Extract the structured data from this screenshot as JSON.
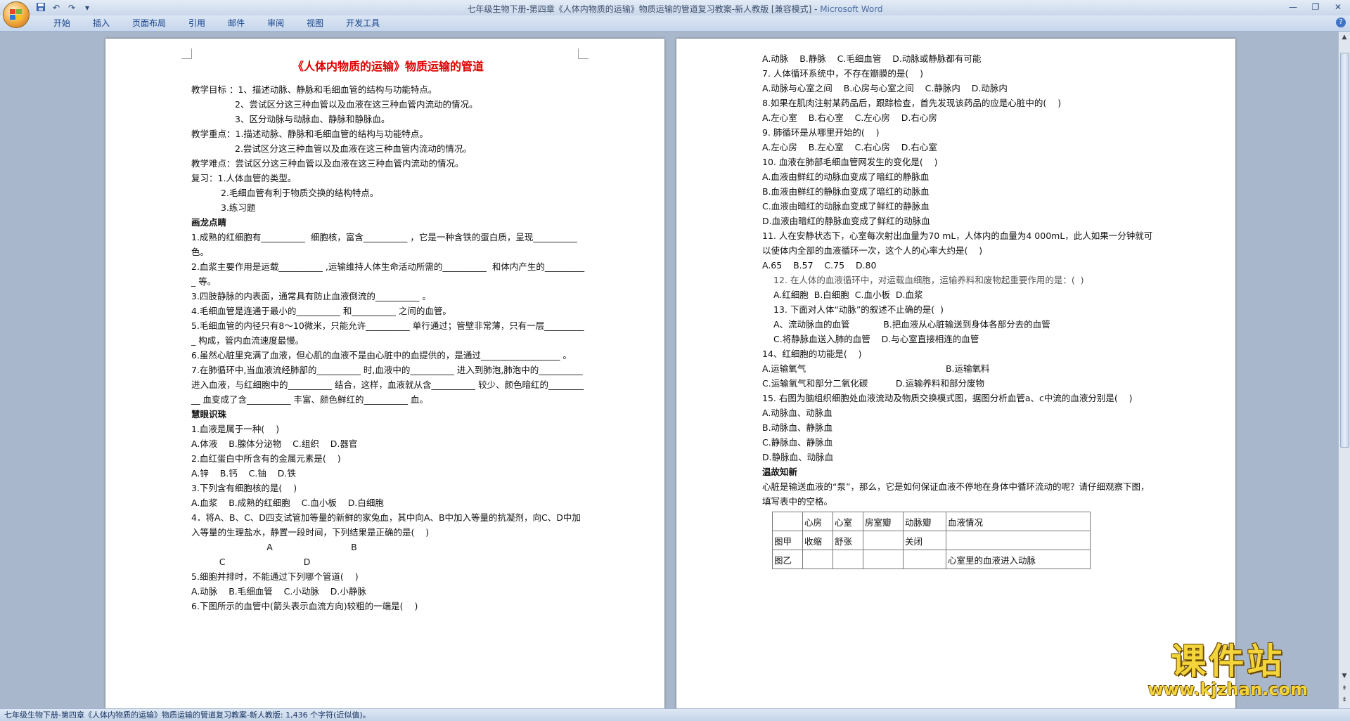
{
  "window": {
    "title": "七年级生物下册-第四章《人体内物质的运输》物质运输的管道复习教案-新人教版 [兼容模式] - ",
    "app_name": "Microsoft Word"
  },
  "menu": [
    "开始",
    "插入",
    "页面布局",
    "引用",
    "邮件",
    "审阅",
    "视图",
    "开发工具"
  ],
  "page1": {
    "title": "《人体内物质的运输》物质运输的管道",
    "lines": [
      {
        "t": "教学目标 ：1、描述动脉、静脉和毛细血管的结构与功能特点。",
        "s": ""
      },
      {
        "t": "2、尝试区分这三种血管以及血液在这三种血管内流动的情况。",
        "s": "indent2"
      },
      {
        "t": "3、区分动脉与动脉血、静脉和静脉血。",
        "s": "indent2"
      },
      {
        "t": "教学重点：1.描述动脉、静脉和毛细血管的结构与功能特点。",
        "s": ""
      },
      {
        "t": "2.尝试区分这三种血管以及血液在这三种血管内流动的情况。",
        "s": "indent2"
      },
      {
        "t": "教学难点：尝试区分这三种血管以及血液在这三种血管内流动的情况。",
        "s": ""
      },
      {
        "t": "复习：1.人体血管的类型。",
        "s": ""
      },
      {
        "t": "2.毛细血管有利于物质交换的结构特点。",
        "s": "indent3"
      },
      {
        "t": "3.练习题",
        "s": "indent3"
      },
      {
        "t": "画龙点睛",
        "s": "bold"
      },
      {
        "t": "1.成熟的红细胞有__________  细胞核，富含__________ ，它是一种含铁的蛋白质，呈现__________ 色。",
        "s": ""
      },
      {
        "t": "2.血浆主要作用是运载__________ ,运输维持人体生命活动所需的__________  和体内产生的__________ 等。",
        "s": ""
      },
      {
        "t": "3.四肢静脉的内表面，通常具有防止血液倒流的__________ 。",
        "s": ""
      },
      {
        "t": "4.毛细血管是连通于最小的__________ 和__________ 之间的血管。",
        "s": ""
      },
      {
        "t": "5.毛细血管的内径只有8～10微米，只能允许__________ 单行通过；管壁非常薄，只有一层__________ 构成，管内血流速度最慢。",
        "s": ""
      },
      {
        "t": "6.虽然心脏里充满了血液，但心肌的血液不是由心脏中的血提供的，是通过__________________ 。",
        "s": ""
      },
      {
        "t": "7.在肺循环中,当血液流经肺部的__________ 时,血液中的__________ 进入到肺泡,肺泡中的__________ 进入血液，与红细胞中的__________ 结合，这样，血液就从含__________ 较少、颜色暗红的__________ 血变成了含__________ 丰富、颜色鲜红的__________ 血。",
        "s": ""
      },
      {
        "t": "慧眼识珠",
        "s": "bold"
      },
      {
        "t": "1.血液是属于一种(    )",
        "s": ""
      },
      {
        "t": "A.体液    B.腺体分泌物    C.组织    D.器官",
        "s": ""
      },
      {
        "t": "2.血红蛋白中所含有的金属元素是(    )",
        "s": ""
      },
      {
        "t": "A.锌    B.钙    C.铀    D.铁",
        "s": ""
      },
      {
        "t": "3.下列含有细胞核的是(    )",
        "s": ""
      },
      {
        "t": "A.血浆    B.成熟的红细胞    C.血小板    D.白细胞",
        "s": ""
      },
      {
        "t": "4．将A、B、C、D四支试管加等量的新鲜的家兔血，其中向A、B中加入等量的抗凝剂，向C、D中加入等量的生理盐水，静置一段时间，下列结果是正确的是(    )",
        "s": ""
      },
      {
        "t": "                           A                            B",
        "s": ""
      },
      {
        "t": "          C                            D",
        "s": ""
      },
      {
        "t": "5.细胞并排时，不能通过下列哪个管道(    )",
        "s": ""
      },
      {
        "t": "A.动脉    B.毛细血管    C.小动脉    D.小静脉",
        "s": ""
      },
      {
        "t": "6.下图所示的血管中(箭头表示血流方向)较粗的一端是(    )",
        "s": ""
      }
    ]
  },
  "page2": {
    "lines": [
      {
        "t": "A.动脉    B.静脉    C.毛细血管    D.动脉或静脉都有可能",
        "s": ""
      },
      {
        "t": "7. 人体循环系统中，不存在瓣膜的是(    )",
        "s": ""
      },
      {
        "t": "A.动脉与心室之间    B.心房与心室之间    C.静脉内    D.动脉内",
        "s": ""
      },
      {
        "t": "8.如果在肌肉注射某药品后，跟踪检查，首先发现该药品的应是心脏中的(    )",
        "s": ""
      },
      {
        "t": "A.左心室    B.右心室    C.左心房    D.右心房",
        "s": ""
      },
      {
        "t": "9. 肺循环是从哪里开始的(    )",
        "s": ""
      },
      {
        "t": "A.左心房    B.左心室    C.右心房    D.右心室",
        "s": ""
      },
      {
        "t": "10. 血液在肺部毛细血管网发生的变化是(    )",
        "s": ""
      },
      {
        "t": "A.血液由鲜红的动脉血变成了暗红的静脉血",
        "s": ""
      },
      {
        "t": "B.血液由鲜红的静脉血变成了暗红的动脉血",
        "s": ""
      },
      {
        "t": "C.血液由暗红的动脉血变成了鲜红的静脉血",
        "s": ""
      },
      {
        "t": "D.血液由暗红的静脉血变成了鲜红的动脉血",
        "s": ""
      },
      {
        "t": "11. 人在安静状态下，心室每次射出血量为70 mL，人体内的血量为4 000mL，此人如果一分钟就可以使体内全部的血液循环一次，这个人的心率大约是(    )",
        "s": ""
      },
      {
        "t": "A.65    B.57    C.75    D.80",
        "s": ""
      },
      {
        "t": "12. 在人体的血液循环中，对运载血细胞，运输养料和废物起重要作用的是：(  )",
        "s": "indent gray"
      },
      {
        "t": "A.红细胞  B.白细胞  C.血小板  D.血浆",
        "s": "indent"
      },
      {
        "t": "13. 下面对人体“动脉”的叙述不止确的是(  )",
        "s": "indent"
      },
      {
        "t": "A、流动脉血的血管            B.把血液从心脏输送到身体各部分去的血管",
        "s": "indent"
      },
      {
        "t": "C.将静脉血送入肺的血管    D.与心室直接相连的血管",
        "s": "indent"
      },
      {
        "t": "14、红细胞的功能是(    )",
        "s": ""
      },
      {
        "t": "A.运输氧气                                                  B.运输氧料",
        "s": ""
      },
      {
        "t": "C.运输氧气和部分二氧化碳          D.运输养料和部分废物",
        "s": ""
      },
      {
        "t": "15. 右图为脑组织细胞处血液流动及物质交换模式图，据图分析血管a、c中流的血液分别是(    )",
        "s": ""
      },
      {
        "t": "A.动脉血、动脉血",
        "s": ""
      },
      {
        "t": "B.动脉血、静脉血",
        "s": ""
      },
      {
        "t": "C.静脉血、静脉血",
        "s": ""
      },
      {
        "t": "D.静脉血、动脉血",
        "s": ""
      },
      {
        "t": "温故知新",
        "s": "bold"
      },
      {
        "t": "心脏是输送血液的“泵”，那么，它是如何保证血液不停地在身体中循环流动的呢？请仔细观察下图，填写表中的空格。",
        "s": ""
      }
    ],
    "table": [
      [
        "",
        "心房",
        "心室",
        "房室瓣",
        "动脉瓣",
        "血液情况"
      ],
      [
        "图甲",
        "收缩",
        "舒张",
        "",
        "关闭",
        ""
      ],
      [
        "图乙",
        "",
        "",
        "",
        "",
        "心室里的血液进入动脉"
      ]
    ]
  },
  "status": {
    "text": "七年级生物下册-第四章《人体内物质的运输》物质运输的管道复习教案-新人教版: 1,436 个字符(近似值)。"
  },
  "watermark": {
    "big": "课件站",
    "url": "www.kjzhan.com"
  },
  "colors": {
    "title_red": "#e00000",
    "ribbon_bg": "#c6d6ec",
    "workspace_bg": "#a8b7cb"
  }
}
